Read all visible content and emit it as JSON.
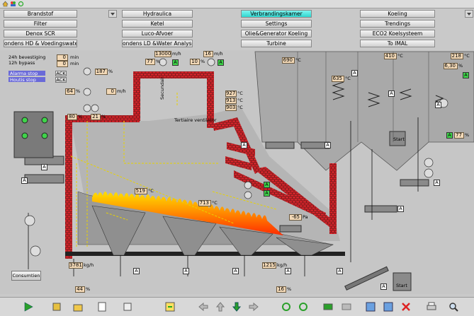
{
  "nav": {
    "row1": [
      "Brandstof",
      "Hydraulica",
      "Verbrandingskamer",
      "Koeling"
    ],
    "row2": [
      "Filter",
      "Ketel",
      "Settings",
      "Trendings"
    ],
    "row3": [
      "Denox SCR",
      "Luco-Afvoer",
      "Olie&Generator Koeling",
      "ECO2 Koelsysteem"
    ],
    "row4": [
      "ondens HD & Voedingswate",
      "ondens LD &Water Analyse",
      "Turbine",
      "To IMAL"
    ]
  },
  "active_tab": "Verbrandingskamer",
  "left_panel": {
    "label_24h": "24h bevestiging",
    "label_12h": "12h bypass",
    "min_24h": "0",
    "min_12h": "0",
    "min_unit": "min",
    "alarm_label": "Alarma stop",
    "alarm_sub": "Houtis stop",
    "ack": "ACK",
    "consumption_button": "Consumtien"
  },
  "values": {
    "v187": "187",
    "v64": "64",
    "v0_mh": "0",
    "v80": "80",
    "v21": "21",
    "v13000": "13000",
    "v77": "77",
    "v16": "16",
    "v10": "10",
    "v690": "690",
    "v927": "927",
    "v913": "913",
    "v903": "903",
    "v635": "635",
    "v410": "410",
    "v218": "218",
    "v630": "6,30",
    "v77b": "77",
    "v519": "519",
    "v713": "713",
    "v_neg65": "-65",
    "v3781": "3781",
    "v44": "44",
    "v1215": "1215",
    "v16b": "16",
    "v36": "36",
    "v81": "81"
  },
  "units": {
    "pct": "%",
    "mh": "m/h",
    "degc": "°C",
    "mbar": "mbar",
    "pa": "Pa",
    "kgh": "kg/h"
  },
  "labels": {
    "secundair": "Secundair",
    "tertiaire": "Tertiaire ventilator",
    "start": "Start",
    "start2": "Start"
  },
  "colors": {
    "brick": "#d8262e",
    "panel": "#c6c6c6",
    "value_bg": "#f3d9b7",
    "green": "#3fd34a",
    "active_tab": "#2fd6cf"
  }
}
